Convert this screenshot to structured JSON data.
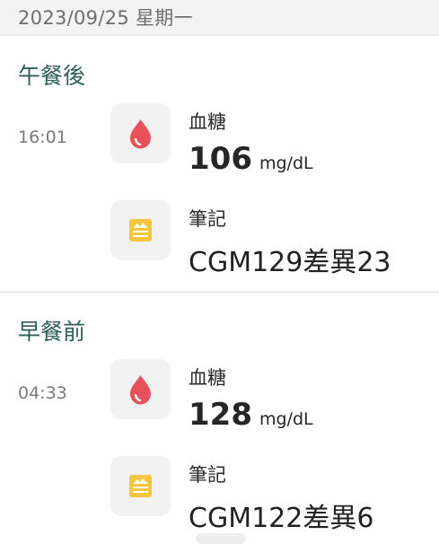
{
  "date_header": "2023/09/25 星期一",
  "sections": [
    {
      "title": "午餐後",
      "time": "16:01",
      "glucose": {
        "icon": "blood-drop-icon",
        "label": "血糖",
        "value": "106",
        "unit": "mg/dL"
      },
      "note": {
        "icon": "note-icon",
        "label": "筆記",
        "text": "CGM129差異23"
      }
    },
    {
      "title": "早餐前",
      "time": "04:33",
      "glucose": {
        "icon": "blood-drop-icon",
        "label": "血糖",
        "value": "128",
        "unit": "mg/dL"
      },
      "note": {
        "icon": "note-icon",
        "label": "筆記",
        "text": "CGM122差異6"
      }
    }
  ],
  "colors": {
    "section_title": "#2f5f57",
    "drop": "#e8505b",
    "note": "#f6c53f",
    "tile_bg": "#f2f2f2"
  }
}
